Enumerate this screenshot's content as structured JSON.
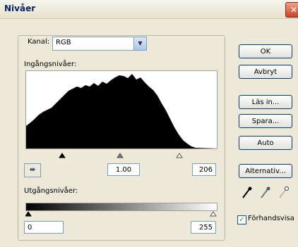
{
  "window": {
    "title": "Nivåer",
    "close_symbol": "✕"
  },
  "channel": {
    "label": "Kanal:",
    "value": "RGB"
  },
  "input_levels": {
    "label": "Ingångsnivåer:",
    "black": "",
    "gamma": "1.00",
    "white": "206"
  },
  "output_levels": {
    "label": "Utgångsnivåer:",
    "black": "0",
    "white": "255"
  },
  "buttons": {
    "ok": "OK",
    "cancel": "Avbryt",
    "load": "Läs in...",
    "save": "Spara...",
    "auto": "Auto",
    "options": "Alternativ..."
  },
  "preview": {
    "label": "Förhandsvisa",
    "checked": true
  },
  "eyedropper_button": "⇹",
  "icons": [
    "dropdown-arrow-icon",
    "black-eyedropper-icon",
    "gray-eyedropper-icon",
    "white-eyedropper-icon",
    "red-arrow-icon"
  ],
  "colors": {
    "accent": "#e8001c",
    "histogram": "#000000",
    "dialog_bg": "#ece9d8"
  }
}
